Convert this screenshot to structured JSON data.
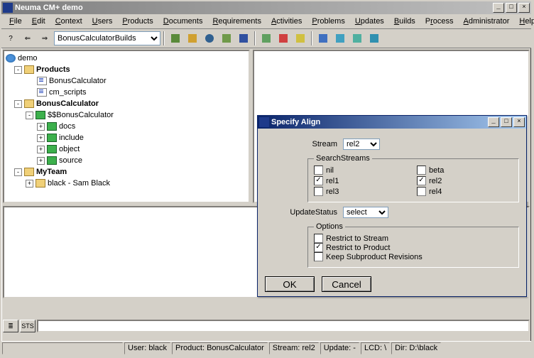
{
  "window": {
    "title": "Neuma CM+ demo"
  },
  "menu": {
    "items": [
      {
        "label": "File",
        "u": "F"
      },
      {
        "label": "Edit",
        "u": "E"
      },
      {
        "label": "Context",
        "u": "C"
      },
      {
        "label": "Users",
        "u": "U"
      },
      {
        "label": "Products",
        "u": "P"
      },
      {
        "label": "Documents",
        "u": "D"
      },
      {
        "label": "Requirements",
        "u": "R"
      },
      {
        "label": "Activities",
        "u": "A"
      },
      {
        "label": "Problems",
        "u": "P"
      },
      {
        "label": "Updates",
        "u": "U"
      },
      {
        "label": "Builds",
        "u": "B"
      },
      {
        "label": "Process",
        "u": "P"
      },
      {
        "label": "Administrator",
        "u": "A"
      },
      {
        "label": "Help",
        "u": "H"
      }
    ]
  },
  "toolbar": {
    "combo": "BonusCalculatorBuilds"
  },
  "tree": {
    "root": "demo",
    "n1": "Products",
    "n1a": "BonusCalculator",
    "n1b": "cm_scripts",
    "n2": "BonusCalculator",
    "n2a": "$$BonusCalculator",
    "n2a1": "docs",
    "n2a2": "include",
    "n2a3": "object",
    "n2a4": "source",
    "n3": "MyTeam",
    "n3a": "black - Sam Black"
  },
  "dialog": {
    "title": "Specify Align",
    "stream_label": "Stream",
    "stream_value": "rel2",
    "search_legend": "SearchStreams",
    "checks": {
      "nil": "nil",
      "beta": "beta",
      "rel1": "rel1",
      "rel2": "rel2",
      "rel3": "rel3",
      "rel4": "rel4"
    },
    "update_label": "UpdateStatus",
    "update_value": "select",
    "options_legend": "Options",
    "opt1": "Restrict to Stream",
    "opt2": "Restrict to Product",
    "opt3": "Keep Subproduct Revisions",
    "ok": "OK",
    "cancel": "Cancel"
  },
  "status": {
    "user_lbl": "User:",
    "user": "black",
    "prod_lbl": "Product:",
    "prod": "BonusCalculator",
    "stream_lbl": "Stream:",
    "stream": "rel2",
    "upd_lbl": "Update:",
    "upd": "-",
    "lcd_lbl": "LCD:",
    "lcd": "\\",
    "dir_lbl": "Dir:",
    "dir": "D:\\black"
  },
  "bottombar": {
    "b1": "≣",
    "b2": "STS"
  }
}
